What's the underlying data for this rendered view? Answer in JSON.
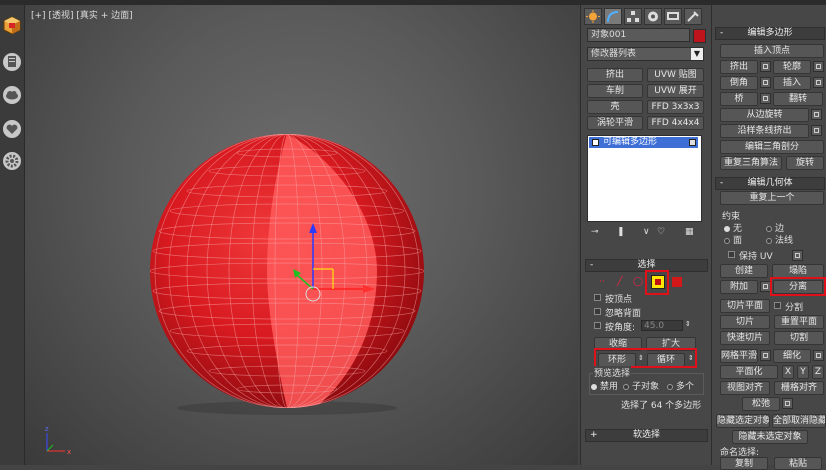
{
  "viewport": {
    "label_plus": "[+]",
    "label_persp": "[透视]",
    "label_shade": "[真实 + 边面]"
  },
  "cmd_tabs": [
    "create-icon",
    "modify-icon",
    "hierarchy-icon",
    "motion-icon",
    "display-icon",
    "utilities-icon"
  ],
  "object": {
    "name": "对象001",
    "color": "#c0141c",
    "modifier_list": "修改器列表"
  },
  "mod_buttons": [
    {
      "label": "挤出"
    },
    {
      "label": "UVW 贴图"
    },
    {
      "label": "车削"
    },
    {
      "label": "UVW 展开"
    },
    {
      "label": "壳"
    },
    {
      "label": "FFD 3x3x3"
    },
    {
      "label": "涡轮平滑"
    },
    {
      "label": "FFD 4x4x4"
    }
  ],
  "stack": {
    "item": "可编辑多边形"
  },
  "selection": {
    "title": "选择",
    "by_vertex": "按顶点",
    "ignore_back": "忽略背面",
    "by_angle": "按角度:",
    "angle_value": "45.0",
    "shrink": "收缩",
    "grow": "扩大",
    "ring": "环形",
    "loop": "循环",
    "preview_title": "预览选择",
    "preview_off": "禁用",
    "preview_sub": "子对象",
    "preview_multi": "多个",
    "status": "选择了 64 个多边形"
  },
  "soft_select": {
    "title": "软选择"
  },
  "edit_poly": {
    "title": "编辑多边形",
    "insert_vertex": "插入顶点",
    "extrude": "挤出",
    "outline": "轮廓",
    "bevel": "倒角",
    "inset": "插入",
    "bridge": "桥",
    "flip": "翻转",
    "hinge": "从边旋转",
    "extrude_spline": "沿样条线挤出",
    "edit_tri": "编辑三角剖分",
    "retri": "重复三角算法",
    "turn": "旋转"
  },
  "edit_geo": {
    "title": "编辑几何体",
    "repeat_last": "重复上一个",
    "constraints": "约束",
    "c_none": "无",
    "c_edge": "边",
    "c_face": "面",
    "c_normal": "法线",
    "preserve_uv": "保持 UV",
    "create": "创建",
    "collapse": "塌陷",
    "attach": "附加",
    "detach": "分离",
    "slice_plane": "切片平面",
    "split": "分割",
    "slice": "切片",
    "reset_plane": "重置平面",
    "quickslice": "快速切片",
    "cut": "切割",
    "msmooth": "网格平滑",
    "tessellate": "细化",
    "planar": "平面化",
    "x": "X",
    "y": "Y",
    "z": "Z",
    "view_align": "视图对齐",
    "grid_align": "栅格对齐",
    "relax": "松弛",
    "hide_sel": "隐藏选定对象",
    "unhide_all": "全部取消隐藏",
    "hide_unsel": "隐藏未选定对象",
    "named_sel": "命名选择:",
    "copy": "复制",
    "paste": "粘贴"
  }
}
